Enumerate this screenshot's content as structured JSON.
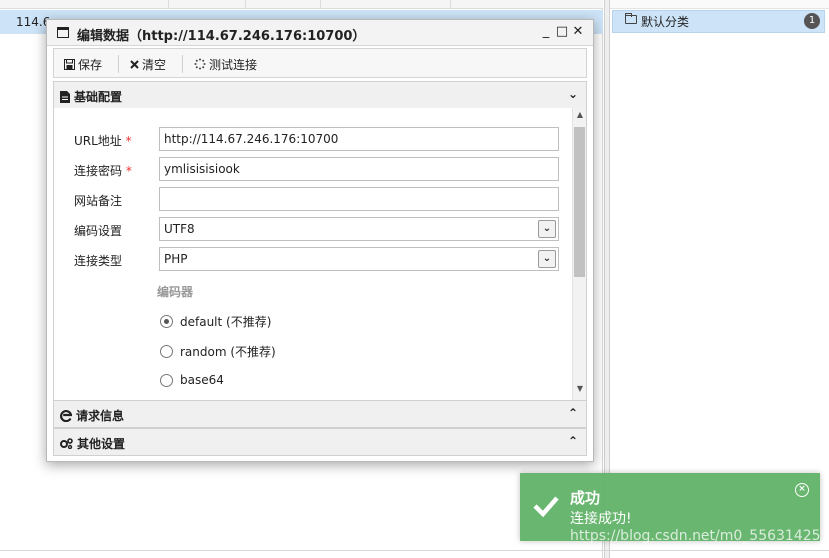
{
  "background": {
    "row_text": "114.6",
    "category": {
      "label": "默认分类",
      "count": "1"
    }
  },
  "dialog": {
    "title": "编辑数据（http://114.67.246.176:10700）",
    "window_buttons": {
      "minimize": "_",
      "maximize": "□",
      "close": "✕"
    },
    "toolbar": {
      "save": "保存",
      "clear": "清空",
      "test": "测试连接"
    },
    "panels": {
      "basic": {
        "title": "基础配置",
        "chevron": "⌄"
      },
      "request": {
        "title": "请求信息",
        "chevron": "⌃"
      },
      "other": {
        "title": "其他设置",
        "chevron": "⌃"
      }
    },
    "form": {
      "url": {
        "label": "URL地址",
        "required": "*",
        "value": "http://114.67.246.176:10700"
      },
      "password": {
        "label": "连接密码",
        "required": "*",
        "value": "ymlisisisiook"
      },
      "note": {
        "label": "网站备注",
        "value": ""
      },
      "encoding": {
        "label": "编码设置",
        "value": "UTF8"
      },
      "type": {
        "label": "连接类型",
        "value": "PHP"
      },
      "encoder_label": "编码器",
      "encoders": [
        {
          "label": "default (不推荐)",
          "checked": true
        },
        {
          "label": "random (不推荐)",
          "checked": false
        },
        {
          "label": "base64",
          "checked": false
        }
      ]
    }
  },
  "toast": {
    "title": "成功",
    "message": "连接成功!",
    "close": "×",
    "color": "#62b36a"
  },
  "watermark": "https://blog.csdn.net/m0_55631425"
}
